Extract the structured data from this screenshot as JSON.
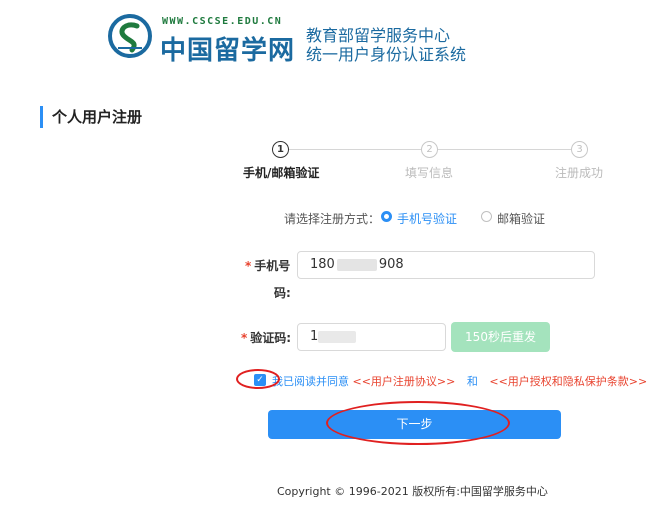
{
  "header": {
    "url_text": "WWW.CSCSE.EDU.CN",
    "site_name": "中国留学网",
    "system_line1": "教育部留学服务中心",
    "system_line2": "统一用户身份认证系统"
  },
  "page": {
    "title": "个人用户注册"
  },
  "steps": [
    {
      "number": "1",
      "label": "手机/邮箱验证",
      "active": true
    },
    {
      "number": "2",
      "label": "填写信息",
      "active": false
    },
    {
      "number": "3",
      "label": "注册成功",
      "active": false
    }
  ],
  "method": {
    "label": "请选择注册方式：",
    "options": [
      "手机号验证",
      "邮箱验证"
    ],
    "selected": "手机号验证"
  },
  "form": {
    "phone_label_line1": "手机号",
    "phone_label_line2": "码:",
    "phone_prefix": "180",
    "phone_suffix": "908",
    "code_label": "验证码:",
    "code_prefix": "1",
    "resend_label": "150秒后重发"
  },
  "agreement": {
    "checked": true,
    "text": "我已阅读并同意",
    "link1": "<<用户注册协议>>",
    "and": "和",
    "link2": "<<用户授权和隐私保护条款>>"
  },
  "actions": {
    "next_label": "下一步"
  },
  "footer": {
    "copyright": "Copyright © 1996-2021 版权所有:中国留学服务中心"
  },
  "colors": {
    "primary": "#2b8ff5",
    "resend_disabled": "#a4e3bd",
    "required": "#e8432f",
    "annotation": "#e02020",
    "brand_green": "#1f7a3e",
    "brand_blue": "#1b6aa0"
  }
}
